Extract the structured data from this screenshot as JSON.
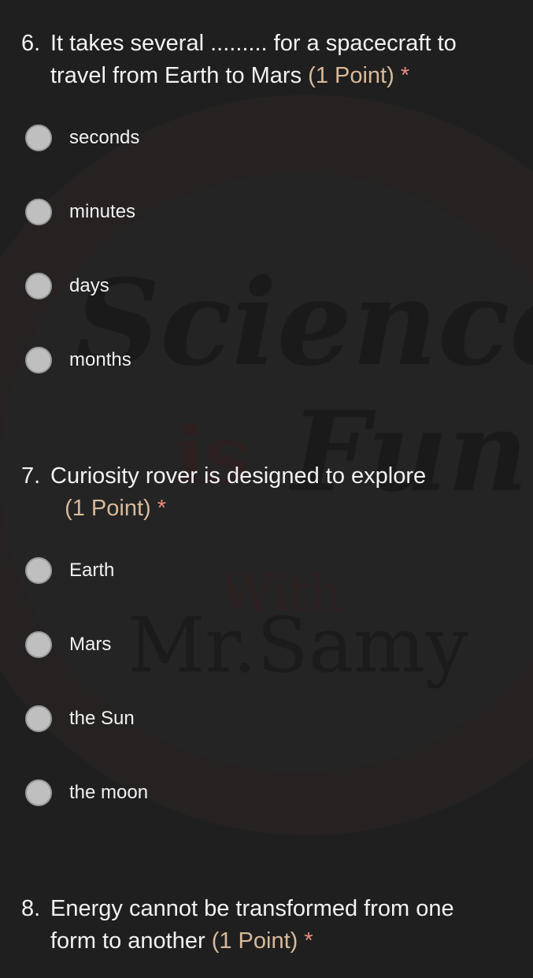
{
  "watermark": {
    "line1": "Science",
    "line2_a": "is",
    "line2_b": "Fun",
    "line3": "With",
    "line4": "Mr.Samy"
  },
  "questions": [
    {
      "number": "6.",
      "text_line1": "It takes several ......... for a spacecraft to",
      "text_line2": "travel from Earth to Mars",
      "points": "(1 Point)",
      "required": "*",
      "options": [
        "seconds",
        "minutes",
        "days",
        "months"
      ]
    },
    {
      "number": "7.",
      "text_line1": "Curiosity rover is designed to explore",
      "text_line2": "",
      "points": "(1 Point)",
      "required": "*",
      "options": [
        "Earth",
        "Mars",
        "the Sun",
        "the moon"
      ]
    },
    {
      "number": "8.",
      "text_line1": "Energy cannot be transformed from one",
      "text_line2": "form to another",
      "points": "(1 Point)",
      "required": "*",
      "options": []
    }
  ],
  "colors": {
    "background": "#1f1f1f",
    "points": "#d9b99a",
    "required": "#f08a80",
    "radio": "#bfbfbf"
  }
}
